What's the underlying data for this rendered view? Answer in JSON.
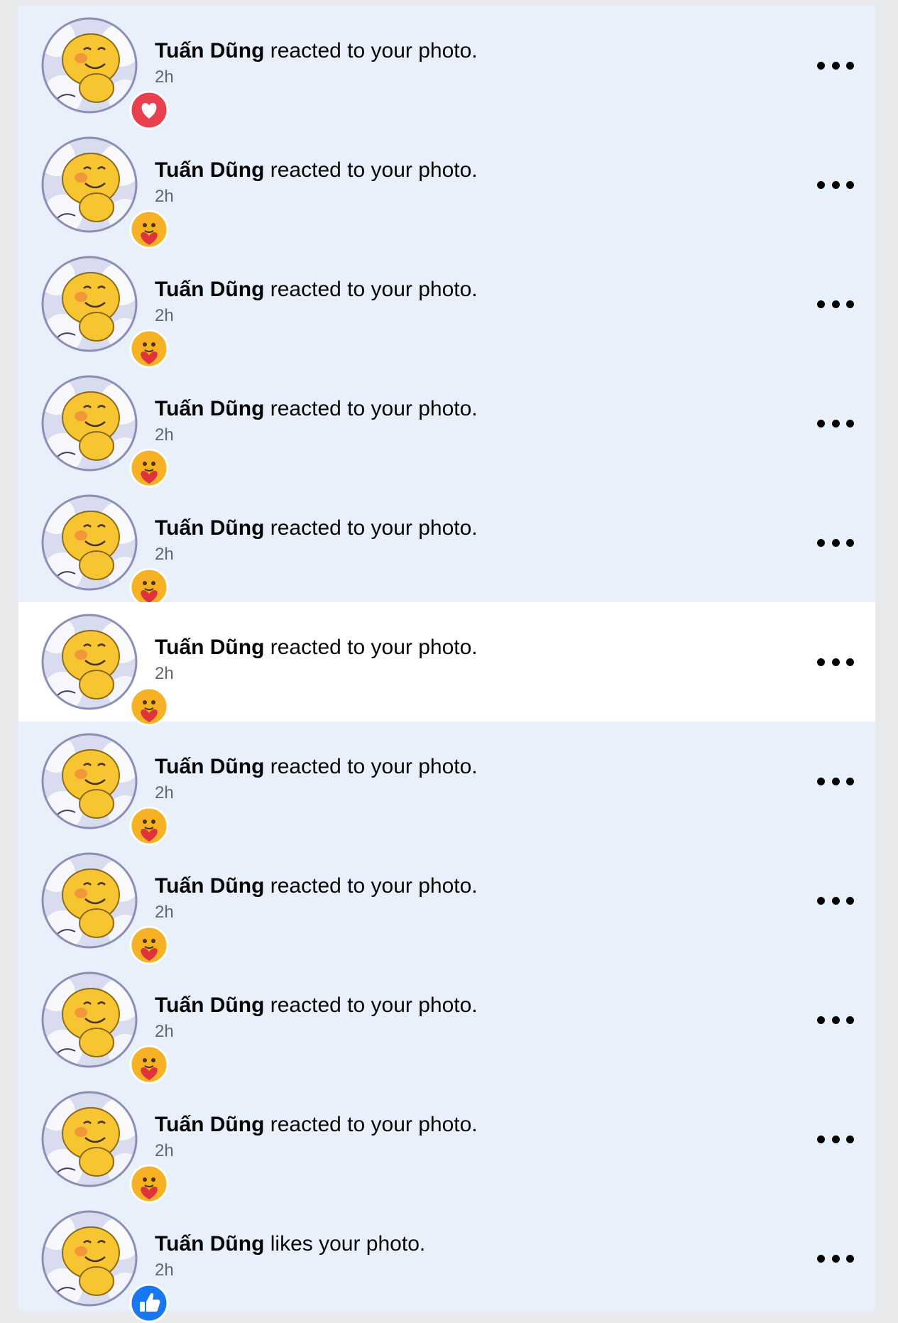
{
  "notifications": [
    {
      "name": "Tuấn Dũng",
      "action": " reacted to your photo.",
      "time": "2h",
      "reaction": "love",
      "read": false
    },
    {
      "name": "Tuấn Dũng",
      "action": " reacted to your photo.",
      "time": "2h",
      "reaction": "care",
      "read": false
    },
    {
      "name": "Tuấn Dũng",
      "action": " reacted to your photo.",
      "time": "2h",
      "reaction": "care",
      "read": false
    },
    {
      "name": "Tuấn Dũng",
      "action": " reacted to your photo.",
      "time": "2h",
      "reaction": "care",
      "read": false
    },
    {
      "name": "Tuấn Dũng",
      "action": " reacted to your photo.",
      "time": "2h",
      "reaction": "care",
      "read": false
    },
    {
      "name": "Tuấn Dũng",
      "action": " reacted to your photo.",
      "time": "2h",
      "reaction": "care",
      "read": true
    },
    {
      "name": "Tuấn Dũng",
      "action": " reacted to your photo.",
      "time": "2h",
      "reaction": "care",
      "read": false
    },
    {
      "name": "Tuấn Dũng",
      "action": " reacted to your photo.",
      "time": "2h",
      "reaction": "care",
      "read": false
    },
    {
      "name": "Tuấn Dũng",
      "action": " reacted to your photo.",
      "time": "2h",
      "reaction": "care",
      "read": false
    },
    {
      "name": "Tuấn Dũng",
      "action": " reacted to your photo.",
      "time": "2h",
      "reaction": "care",
      "read": false
    },
    {
      "name": "Tuấn Dũng",
      "action": " likes your photo.",
      "time": "2h",
      "reaction": "like",
      "read": false
    }
  ],
  "colors": {
    "unread_bg": "#e7f0fb",
    "read_bg": "#ffffff",
    "love": "#e8404f",
    "like": "#1877f2",
    "care": "#f7b125"
  },
  "icons": {
    "more": "more-dots-icon",
    "love": "heart-reaction-icon",
    "care": "care-reaction-icon",
    "like": "thumbs-up-reaction-icon"
  }
}
